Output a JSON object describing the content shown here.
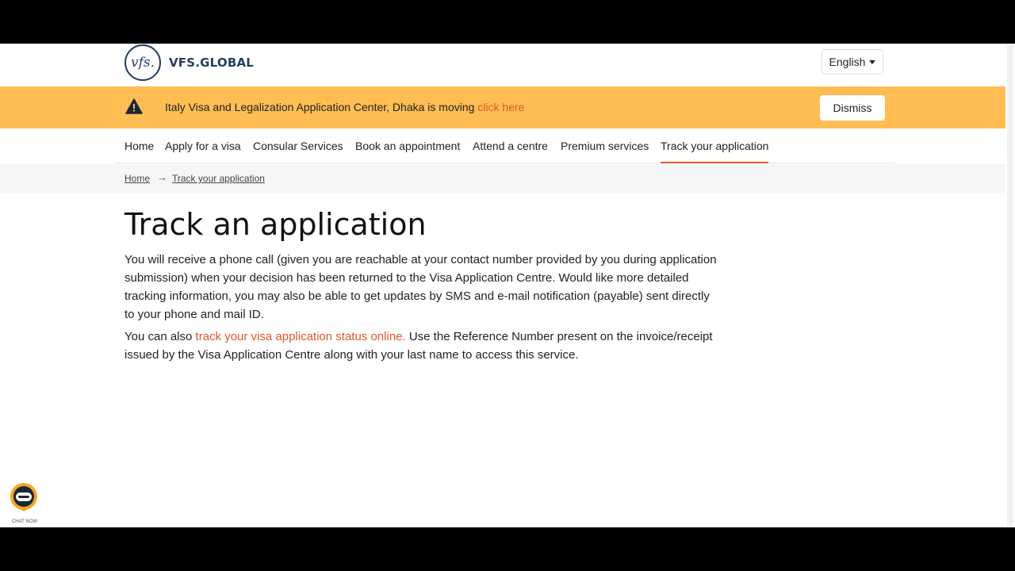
{
  "header": {
    "logo_mark": "vfs.",
    "logo_text": "VFS.GLOBAL",
    "language": "English"
  },
  "banner": {
    "message": "Italy Visa and Legalization Application Center, Dhaka is moving",
    "link": "click here",
    "dismiss": "Dismiss"
  },
  "nav": {
    "items": [
      {
        "label": "Home"
      },
      {
        "label": "Apply for a visa"
      },
      {
        "label": "Consular Services"
      },
      {
        "label": "Book an appointment"
      },
      {
        "label": "Attend a centre"
      },
      {
        "label": "Premium services"
      },
      {
        "label": "Track your application"
      }
    ],
    "active": "Track your application"
  },
  "breadcrumb": {
    "home": "Home",
    "current": "Track your application"
  },
  "content": {
    "title": "Track an application",
    "para1": "You will receive a phone call (given you are reachable at your contact number provided by you during application submission) when your decision has been returned to the Visa Application Centre. Would like more detailed tracking information, you may also be able to get updates by SMS and e-mail notification (payable) sent directly to your phone and mail ID.",
    "para2_prefix": "You can also ",
    "para2_link": "track your visa application status online.",
    "para2_suffix": " Use the Reference Number present on the invoice/receipt issued by the Visa Application Centre along with your last name to access this service."
  },
  "chat": {
    "label": "CHAT NOW"
  },
  "colors": {
    "banner_bg": "#ffbd54",
    "accent": "#e0572a",
    "brand_navy": "#243e63"
  }
}
